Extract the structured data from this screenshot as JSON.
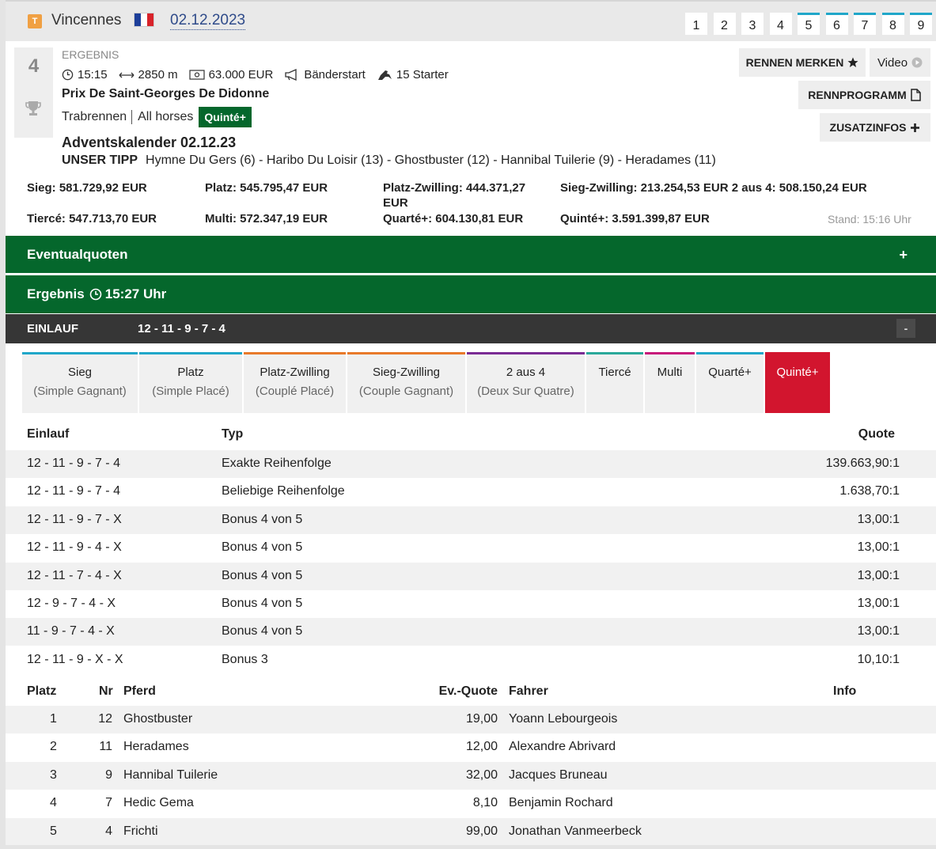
{
  "header": {
    "track_badge": "T",
    "track_name": "Vincennes",
    "date": "02.12.2023",
    "race_tabs": [
      "1",
      "2",
      "3",
      "4",
      "5",
      "6",
      "7",
      "8",
      "9"
    ]
  },
  "race": {
    "number": "4",
    "status_label": "ERGEBNIS",
    "time": "15:15",
    "distance": "2850 m",
    "prize": "63.000 EUR",
    "start_type": "Bänderstart",
    "starters": "15 Starter",
    "title": "Prix De Saint-Georges De Didonne",
    "race_type": "Trabrennen",
    "horses": "All horses",
    "badge": "Quinté+",
    "event_title": "Adventskalender 02.12.23",
    "tipp_label": "UNSER TIPP",
    "tipp": "Hymne Du Gers (6) - Haribo Du Loisir (13) - Ghostbuster (12) - Hannibal Tuilerie (9) - Heradames (11)"
  },
  "buttons": {
    "merken": "RENNEN MERKEN",
    "video": "Video",
    "programm": "RENNPROGRAMM",
    "zusatz": "ZUSATZINFOS"
  },
  "pools": {
    "sieg": "Sieg: 581.729,92 EUR",
    "platz": "Platz: 545.795,47 EUR",
    "platz_zwilling_1": "Platz-Zwilling: 444.371,27",
    "platz_zwilling_2": "EUR",
    "sieg_zwilling": "Sieg-Zwilling: 213.254,53 EUR 2 aus 4: 508.150,24 EUR",
    "tierce": "Tiercé: 547.713,70 EUR",
    "multi": "Multi: 572.347,19 EUR",
    "quarte": "Quarté+: 604.130,81 EUR",
    "quinte": "Quinté+: 3.591.399,87 EUR",
    "stand": "Stand: 15:16 Uhr"
  },
  "sections": {
    "eventualquoten": "Eventualquoten",
    "plus": "+",
    "ergebnis": "Ergebnis",
    "ergebnis_time": "15:27 Uhr",
    "einlauf_label": "EINLAUF",
    "einlauf_value": "12 - 11 - 9 - 7 - 4",
    "minus": "-"
  },
  "bet_tabs": [
    {
      "label": "Sieg",
      "sub": "(Simple Gagnant)",
      "color": "#20a7c9"
    },
    {
      "label": "Platz",
      "sub": "(Simple Placé)",
      "color": "#20a7c9"
    },
    {
      "label": "Platz-Zwilling",
      "sub": "(Couplé Placé)",
      "color": "#e8792a"
    },
    {
      "label": "Sieg-Zwilling",
      "sub": "(Couple Gagnant)",
      "color": "#e8792a"
    },
    {
      "label": "2 aus 4",
      "sub": "(Deux Sur Quatre)",
      "color": "#7a2b94"
    },
    {
      "label": "Tiercé",
      "sub": "",
      "color": "#2aa89a"
    },
    {
      "label": "Multi",
      "sub": "",
      "color": "#c7187a"
    },
    {
      "label": "Quarté+",
      "sub": "",
      "color": "#20a7c9"
    },
    {
      "label": "Quinté+",
      "sub": "",
      "color": "#d2152e"
    }
  ],
  "quote_table": {
    "headers": {
      "einlauf": "Einlauf",
      "typ": "Typ",
      "quote": "Quote"
    },
    "rows": [
      {
        "einlauf": "12 - 11 - 9 - 7 - 4",
        "typ": "Exakte Reihenfolge",
        "quote": "139.663,90:1"
      },
      {
        "einlauf": "12 - 11 - 9 - 7 - 4",
        "typ": "Beliebige Reihenfolge",
        "quote": "1.638,70:1"
      },
      {
        "einlauf": "12 - 11 - 9 - 7 - X",
        "typ": "Bonus 4 von 5",
        "quote": "13,00:1"
      },
      {
        "einlauf": "12 - 11 - 9 - 4 - X",
        "typ": "Bonus 4 von 5",
        "quote": "13,00:1"
      },
      {
        "einlauf": "12 - 11 - 7 - 4 - X",
        "typ": "Bonus 4 von 5",
        "quote": "13,00:1"
      },
      {
        "einlauf": "12 - 9 - 7 - 4 - X",
        "typ": "Bonus 4 von 5",
        "quote": "13,00:1"
      },
      {
        "einlauf": "11 - 9 - 7 - 4 - X",
        "typ": "Bonus 4 von 5",
        "quote": "13,00:1"
      },
      {
        "einlauf": "12 - 11 - 9 - X - X",
        "typ": "Bonus 3",
        "quote": "10,10:1"
      }
    ]
  },
  "result_table": {
    "headers": {
      "platz": "Platz",
      "nr": "Nr",
      "pferd": "Pferd",
      "evquote": "Ev.-Quote",
      "fahrer": "Fahrer",
      "info": "Info"
    },
    "rows": [
      {
        "platz": "1",
        "nr": "12",
        "pferd": "Ghostbuster",
        "evquote": "19,00",
        "fahrer": "Yoann Lebourgeois"
      },
      {
        "platz": "2",
        "nr": "11",
        "pferd": "Heradames",
        "evquote": "12,00",
        "fahrer": "Alexandre Abrivard"
      },
      {
        "platz": "3",
        "nr": "9",
        "pferd": "Hannibal Tuilerie",
        "evquote": "32,00",
        "fahrer": "Jacques Bruneau"
      },
      {
        "platz": "4",
        "nr": "7",
        "pferd": "Hedic Gema",
        "evquote": "8,10",
        "fahrer": "Benjamin Rochard"
      },
      {
        "platz": "5",
        "nr": "4",
        "pferd": "Frichti",
        "evquote": "99,00",
        "fahrer": "Jonathan Vanmeerbeck"
      }
    ]
  },
  "colors": {
    "green": "#05672c",
    "red": "#d2152e",
    "dark": "#363636",
    "link": "#2f4b8a"
  }
}
